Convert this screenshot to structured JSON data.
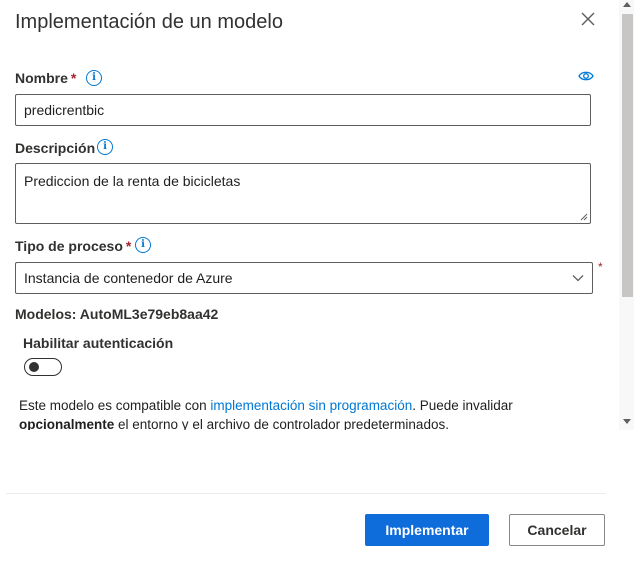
{
  "dialog": {
    "title": "Implementación de un modelo",
    "close_icon": "close-icon"
  },
  "form": {
    "name": {
      "label": "Nombre",
      "required_mark": "*",
      "value": "predicrentbic",
      "info_icon": "info-icon",
      "visibility_icon": "eye-icon"
    },
    "description": {
      "label": "Descripción",
      "value": "Prediccion de la renta de bicicletas",
      "info_icon": "info-icon"
    },
    "compute_type": {
      "label": "Tipo de proceso",
      "required_mark": "*",
      "selected": "Instancia de contenedor de Azure",
      "side_required_mark": "*",
      "info_icon": "info-icon"
    },
    "models_text": "Modelos: AutoML3e79eb8aa42",
    "auth": {
      "label": "Habilitar autenticación",
      "enabled": false
    },
    "note": {
      "prefix": "Este modelo es compatible con ",
      "link": "implementación sin programación",
      "middle": ". Puede invalidar ",
      "bold": "opcionalmente",
      "suffix": " el entorno y el archivo de controlador predeterminados."
    }
  },
  "footer": {
    "primary_label": "Implementar",
    "cancel_label": "Cancelar"
  },
  "colors": {
    "accent": "#0078d4",
    "primary_button": "#0f6cdb",
    "required": "#a4262c"
  }
}
